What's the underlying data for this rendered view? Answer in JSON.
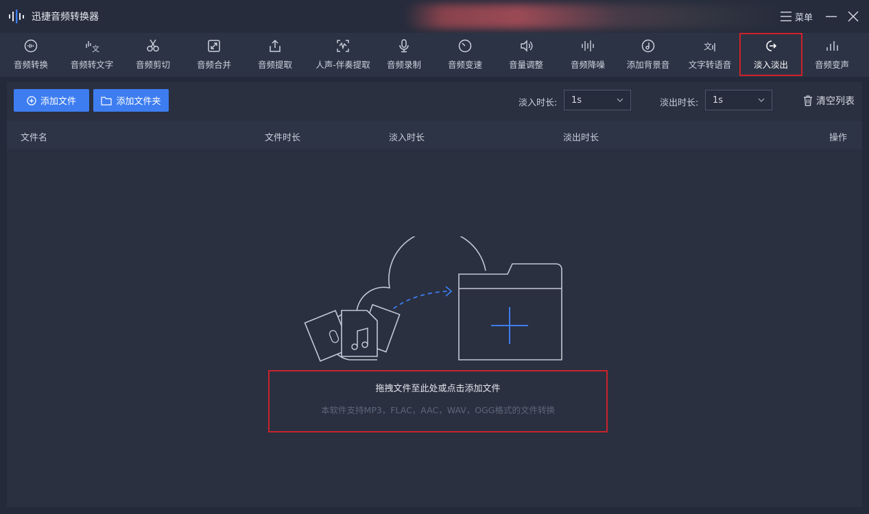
{
  "app": {
    "title": "迅捷音频转换器"
  },
  "window": {
    "menu_label": "菜单"
  },
  "toolbar": {
    "items": [
      {
        "label": "音频转换",
        "icon": "audio-convert-icon"
      },
      {
        "label": "音频转文字",
        "icon": "audio-to-text-icon"
      },
      {
        "label": "音频剪切",
        "icon": "scissors-icon"
      },
      {
        "label": "音频合并",
        "icon": "merge-icon"
      },
      {
        "label": "音频提取",
        "icon": "upload-icon"
      },
      {
        "label": "人声-伴奏提取",
        "icon": "vocal-extract-icon"
      },
      {
        "label": "音频录制",
        "icon": "microphone-icon"
      },
      {
        "label": "音频变速",
        "icon": "speed-icon"
      },
      {
        "label": "音量调整",
        "icon": "volume-icon"
      },
      {
        "label": "音频降噪",
        "icon": "denoise-icon"
      },
      {
        "label": "添加背景音",
        "icon": "background-music-icon"
      },
      {
        "label": "文字转语音",
        "icon": "text-to-speech-icon"
      },
      {
        "label": "淡入淡出",
        "icon": "fade-icon",
        "active": true
      },
      {
        "label": "音频变声",
        "icon": "voice-change-icon"
      }
    ]
  },
  "actions": {
    "add_file": "添加文件",
    "add_folder": "添加文件夹",
    "fade_in_label": "淡入时长:",
    "fade_in_value": "1s",
    "fade_out_label": "淡出时长:",
    "fade_out_value": "1s",
    "clear_list": "清空列表"
  },
  "table": {
    "columns": [
      "文件名",
      "文件时长",
      "淡入时长",
      "淡出时长",
      "操作"
    ]
  },
  "dropzone": {
    "title": "拖拽文件至此处或点击添加文件",
    "subtitle": "本软件支持MP3，FLAC，AAC，WAV，OGG格式的文件转换"
  },
  "colors": {
    "accent": "#3d7df0",
    "highlight_border": "#d0212a",
    "background": "#242a3a"
  }
}
